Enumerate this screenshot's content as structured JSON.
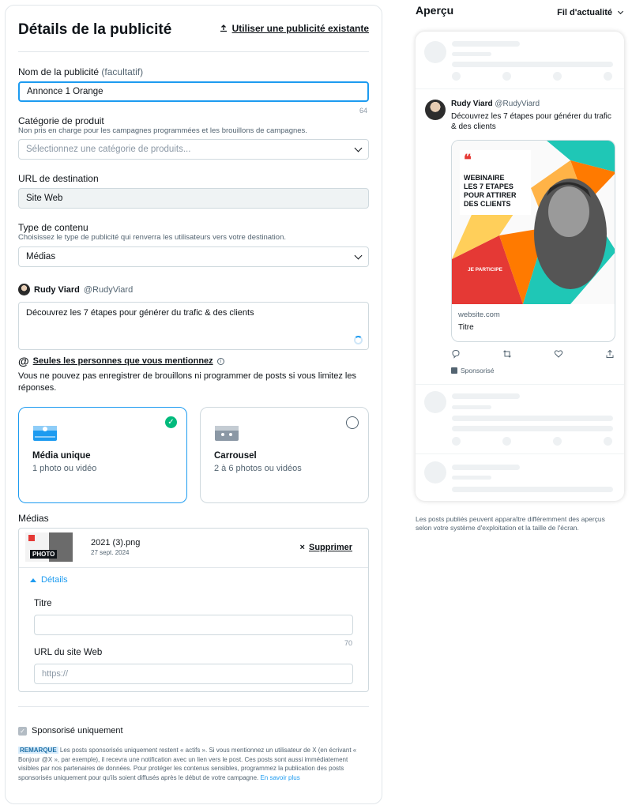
{
  "left": {
    "title": "Détails de la publicité",
    "use_existing": "Utiliser une publicité existante",
    "ad_name": {
      "label": "Nom de la publicité",
      "optional": "(facultatif)",
      "value": "Annonce 1 Orange",
      "counter": "64"
    },
    "product_category": {
      "label": "Catégorie de produit",
      "sub": "Non pris en charge pour les campagnes programmées et les brouillons de campagnes.",
      "placeholder": "Sélectionnez une catégorie de produits..."
    },
    "destination": {
      "label": "URL de destination",
      "value": "Site Web"
    },
    "content_type": {
      "label": "Type de contenu",
      "sub": "Choisissez le type de publicité qui renverra les utilisateurs vers votre destination.",
      "value": "Médias"
    },
    "author": {
      "name": "Rudy Viard",
      "handle": "@RudyViard"
    },
    "post_text": "Découvrez les 7 étapes pour générer du trafic & des clients",
    "mention": {
      "at": "@",
      "label": "Seules les personnes que vous mentionnez",
      "info": "i"
    },
    "warning": "Vous ne pouvez pas enregistrer de brouillons ni programmer de posts si vous limitez les réponses.",
    "format_cards": [
      {
        "title": "Média unique",
        "desc": "1 photo ou vidéo",
        "selected": true
      },
      {
        "title": "Carrousel",
        "desc": "2 à 6 photos ou vidéos",
        "selected": false
      }
    ],
    "check_mark": "✓",
    "media": {
      "label": "Médias",
      "file_name": "2021 (3).png",
      "file_date": "27 sept. 2024",
      "thumb_tag": "PHOTO",
      "delete_x": "×",
      "delete_label": "Supprimer",
      "details_label": "Détails",
      "title_label": "Titre",
      "title_counter": "70",
      "url_label": "URL du site Web",
      "url_placeholder": "https://"
    },
    "sponsored": {
      "check": "✓",
      "label": "Sponsorisé uniquement"
    },
    "note": {
      "badge": "REMARQUE",
      "text": "Les posts sponsorisés uniquement restent « actifs ». Si vous mentionnez un utilisateur de X (en écrivant « Bonjour @X », par exemple), il recevra une notification avec un lien vers le post. Ces posts sont aussi immédiatement visibles par nos partenaires de données. Pour protéger les contenus sensibles, programmez la publication des posts sponsorisés uniquement pour qu'ils soient diffusés après le début de votre campagne.",
      "link": "En savoir plus"
    }
  },
  "right": {
    "title": "Aperçu",
    "feed": "Fil d'actualité",
    "post": {
      "name": "Rudy Viard",
      "handle": "@RudyViard",
      "text": "Découvrez les 7 étapes pour générer du trafic & des clients",
      "ad_headline_1": "WEBINAIRE",
      "ad_headline_2": "LES 7 ETAPES",
      "ad_headline_3": "POUR ATTIRER",
      "ad_headline_4": "DES CLIENTS",
      "ad_button": "JE PARTICIPE",
      "ad_quote": "❝",
      "domain": "website.com",
      "card_title": "Titre",
      "sponsored": "Sponsorisé",
      "icons": [
        "reply-icon",
        "retweet-icon",
        "like-icon",
        "share-icon"
      ]
    },
    "disclaimer": "Les posts publiés peuvent apparaître différemment des aperçus selon votre système d'exploitation et la taille de l'écran."
  },
  "colors": {
    "accent": "#1d9bf0",
    "success": "#00ba7c",
    "ad_red": "#e53935",
    "ad_orange": "#ff7a00",
    "ad_teal": "#1fc7b6"
  }
}
